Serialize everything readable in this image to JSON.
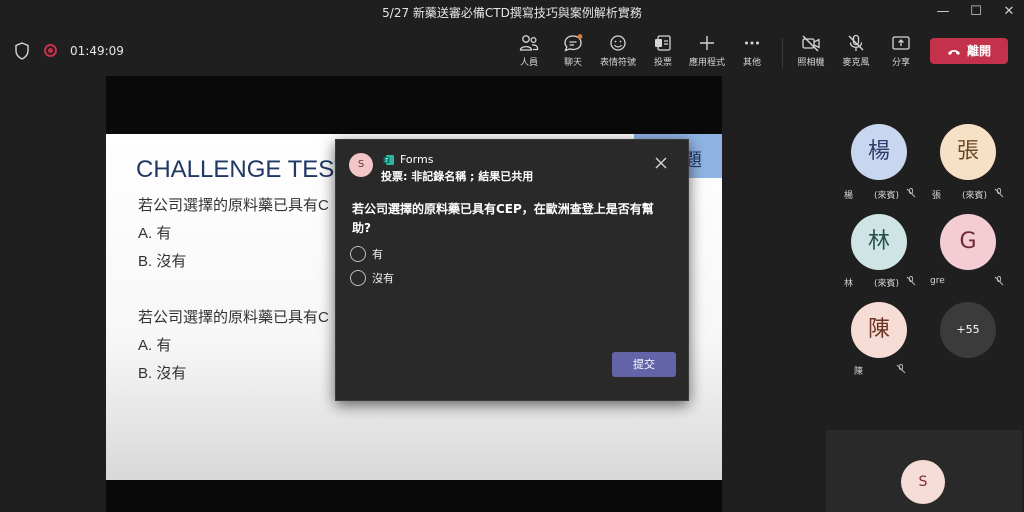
{
  "window": {
    "title": "5/27 新藥送審必備CTD撰寫技巧與案例解析實務",
    "controls": [
      "—",
      "☐",
      "✕"
    ]
  },
  "toolbar": {
    "timer": "01:49:09",
    "buttons": [
      {
        "label": "人員",
        "icon": "people-icon"
      },
      {
        "label": "聊天",
        "icon": "chat-icon"
      },
      {
        "label": "表情符號",
        "icon": "emoji-icon"
      },
      {
        "label": "投票",
        "icon": "poll-icon"
      },
      {
        "label": "應用程式",
        "icon": "add-app-icon"
      },
      {
        "label": "其他",
        "icon": "more-icon"
      },
      {
        "label": "照相機",
        "icon": "camera-off-icon"
      },
      {
        "label": "麥克風",
        "icon": "mic-off-icon"
      },
      {
        "label": "分享",
        "icon": "share-icon"
      }
    ],
    "leave_label": "離開",
    "leave_color": "#c4314b"
  },
  "slide": {
    "title": "CHALLENGE TEST",
    "corner_text": "題",
    "question1": "若公司選擇的原料藥已具有C",
    "q1_a": "A. 有",
    "q1_b": "B. 沒有",
    "question2": "若公司選擇的原料藥已具有C",
    "q2_a": "A. 有",
    "q2_b": "B. 沒有"
  },
  "popup": {
    "avatar": "S",
    "app_name": "Forms",
    "subtitle": "投票: 非記錄名稱 ; 結果已共用",
    "question": "若公司選擇的原料藥已具有CEP，在歐洲查登上是否有幫助?",
    "options": [
      "有",
      "沒有"
    ],
    "submit_label": "提交",
    "accent": "#6264a7"
  },
  "participants": [
    {
      "initial": "楊",
      "name": "楊",
      "role": "(來賓)",
      "bg": "#c8d6f0",
      "fg": "#2f3e6b"
    },
    {
      "initial": "張",
      "name": "張",
      "role": "(來賓)",
      "bg": "#f6e1c6",
      "fg": "#6b4a2a"
    },
    {
      "initial": "林",
      "name": "林",
      "role": "(來賓)",
      "bg": "#cfe4e4",
      "fg": "#2a4f4f"
    },
    {
      "initial": "G",
      "name": "gre",
      "role": "",
      "bg": "#f3cdd3",
      "fg": "#6e2a36"
    },
    {
      "initial": "陳",
      "name": "陳",
      "role": "",
      "bg": "#f5dcd4",
      "fg": "#6b3326"
    },
    {
      "initial": "+55",
      "name": "",
      "role": "",
      "bg": "#3b3b3b",
      "fg": "#ffffff"
    }
  ],
  "self_avatar": "S"
}
